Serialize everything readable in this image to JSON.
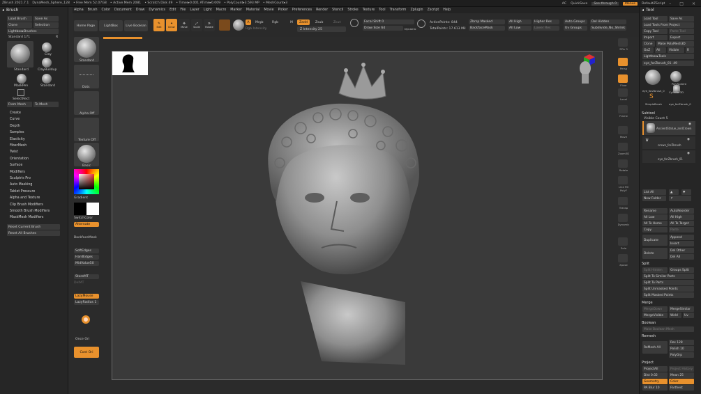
{
  "titlebar": {
    "app": "ZBrush 2021.7.1",
    "doc": "DynaMesh_Sphere_128",
    "mem1": "• Free Mem 52.07GB",
    "mem2": "• Active Mem 2081",
    "mem3": "• Scratch Disk 49",
    "timer": "• Timer▸0.001 ATime▸0.009",
    "poly": "• PolyCount▸3.593 MP",
    "mesh": "• MeshCount▸3",
    "ac": "AC",
    "quicksave": "QuickSave",
    "seethrough": "See-through  0",
    "menus": "Menus",
    "script": "DefaultZScript"
  },
  "menubar": [
    "Alpha",
    "Brush",
    "Color",
    "Document",
    "Draw",
    "Dynamics",
    "Edit",
    "File",
    "Layer",
    "Light",
    "Macro",
    "Marker",
    "Material",
    "Movie",
    "Picker",
    "Preferences",
    "Render",
    "Stencil",
    "Stroke",
    "Texture",
    "Tool",
    "Transform",
    "Zplugin",
    "Zscript",
    "Help"
  ],
  "left": {
    "title": "Brush",
    "load": "Load Brush",
    "saveas": "Save As",
    "clone": "Clone",
    "selection": "Selection",
    "lightbox": "Lightbox▸Brushes",
    "standard": "Standard  171",
    "r": "R",
    "b1": "Standard",
    "b2": "Clay",
    "b3": "ClayBuildup",
    "b4": "MaskPen",
    "b5": "Standard",
    "b6": "SelectRect",
    "frommesh": "From Mesh",
    "tomesh": "To Mesh",
    "menu": [
      "Create",
      "Curve",
      "Depth",
      "Samples",
      "Elasticity",
      "FiberMesh",
      "Twist",
      "Orientation",
      "Surface",
      "Modifiers",
      "Sculptris Pro",
      "Auto Masking",
      "Tablet Pressure",
      "Alpha and Texture",
      "Clip Brush Modifiers",
      "Smooth Brush Modifiers",
      "MaskMesh Modifiers"
    ],
    "reset": "Reset Current Brush",
    "resetall": "Reset All Brushes"
  },
  "shelf": {
    "homepage": "Home Page",
    "lightbox": "LightBox",
    "liveboolean": "Live Boolean",
    "edit": "Edit",
    "draw": "Draw",
    "move": "Move",
    "scale": "Scale",
    "rotate": "Rotate",
    "a": "A",
    "mrgb": "Mrgb",
    "rgb": "Rgb",
    "m": "M",
    "zadd": "Zadd",
    "zsub": "Zsub",
    "zcut": "Zcut",
    "rgbint": "Rgb Intensity",
    "zint": "Z Intensity 25",
    "focal": "Focal Shift 0",
    "drawsize": "Draw Size 64",
    "dynamic": "Dynamic",
    "active": "ActivePoints: 844",
    "total": "TotalPoints: 17.613 Mil",
    "zremesh": "Zbrsp Masked",
    "backface": "BackfaceMask",
    "allhigh": "All High",
    "alllow": "All Low",
    "higher": "Higher Res",
    "lower": "Lower Res",
    "autogroups": "Auto Groups",
    "uvgroups": "Uv Groups",
    "delhidden": "Del Hidden",
    "subdiv": "Subdivide_No_Shrink"
  },
  "strip": {
    "standard": "Standard",
    "dots": "Dots",
    "alphaoff": "Alpha Off",
    "textureoff": "Texture Off",
    "basic": "Basic",
    "gradient": "Gradient",
    "switchcolor": "SwitchColor",
    "alternate": "Alternate",
    "backfacemask": "BackfaceMask",
    "softedges": "SoftEdges",
    "hardedges": "HardEdges",
    "midvalue": "MidValue50",
    "storemt": "StoreMT",
    "delmt": "DelMT",
    "lazymouse": "LazyMouse",
    "lazyradius": "LazyRadius 1",
    "onceori": "Once Ori",
    "contori": "Cont Ori"
  },
  "rightstrip": [
    "SPix 3",
    "Persp",
    "Floor",
    "Local",
    "Frame",
    "Move",
    "Zoom3D",
    "Rotate",
    "Line Fill PolyF",
    "Transp",
    "Dynamic",
    "Solo",
    "Xpose"
  ],
  "right": {
    "title": "Tool",
    "load": "Load Tool",
    "saveas": "Save As",
    "loadproj": "Load Tools From Project",
    "copytool": "Copy Tool",
    "pastetool": "Paste Tool",
    "import": "Import",
    "export": "Export",
    "clone": "Clone",
    "polymesh": "Make PolyMesh3D",
    "goz": "GoZ",
    "all": "All",
    "visible": "Visible",
    "r": "R",
    "lightbox": "Lightbox▸Tools",
    "current": "eye_forZbrush_01. 49",
    "t1": "eye_forZbrush_0",
    "t2": "PolySphere",
    "t3": "SimpleBrush",
    "t4": "Cylinder3D",
    "t5": "eye_forZbrush_0",
    "subtool": "Subtool",
    "visiblecount": "Visible Count 5",
    "st1": "AncientStatue_andCrown",
    "st2": "crown_forZbrush",
    "st3": "eye_forZbrush_01",
    "listall": "List All",
    "newfolder": "New Folder",
    "rename": "Rename",
    "autoreorder": "AutoReorder",
    "alllow": "All Low",
    "allhigh": "All High",
    "alltohome": "All To Home",
    "alltotarget": "All To Target",
    "copy": "Copy",
    "paste": "Paste",
    "duplicate": "Duplicate",
    "append": "Append",
    "insert": "Insert",
    "delete": "Delete",
    "delother": "Del Other",
    "delall": "Del All",
    "split": "Split",
    "splithidden": "Split Hidden",
    "groupssplit": "Groups Split",
    "splitsimilar": "Split To Similar Parts",
    "splitparts": "Split To Parts",
    "splitunmasked": "Split Unmasked Points",
    "splitmasked": "Split Masked Points",
    "merge": "Merge",
    "mergedown": "MergeDown",
    "mergesimilar": "MergeSimilar",
    "mergevisible": "MergeVisible",
    "weld": "Weld",
    "uv": "Uv",
    "boolean": "Boolean",
    "boolmesh": "Make Boolean Mesh",
    "remesh": "Remesh",
    "remeshall": "ReMesh All",
    "res": "Res 128",
    "polish": "Polish 10",
    "polygrp": "PolyGrp",
    "project": "Project",
    "projectall": "ProjectAll",
    "history": "Project History",
    "dist": "Dist 0.02",
    "mean": "Mean 25",
    "geometry": "Geometry",
    "color": "Color",
    "pablur": "PA Blur 10",
    "farthest": "Farthest"
  },
  "colors": {
    "accent": "#e8912d",
    "panel": "#262626",
    "viewport": "#3a3a3a"
  },
  "icons": [
    "brush-thumb-icon",
    "color-picker-icon",
    "head-icon",
    "axis-gizmo-icon",
    "crown-icon"
  ]
}
